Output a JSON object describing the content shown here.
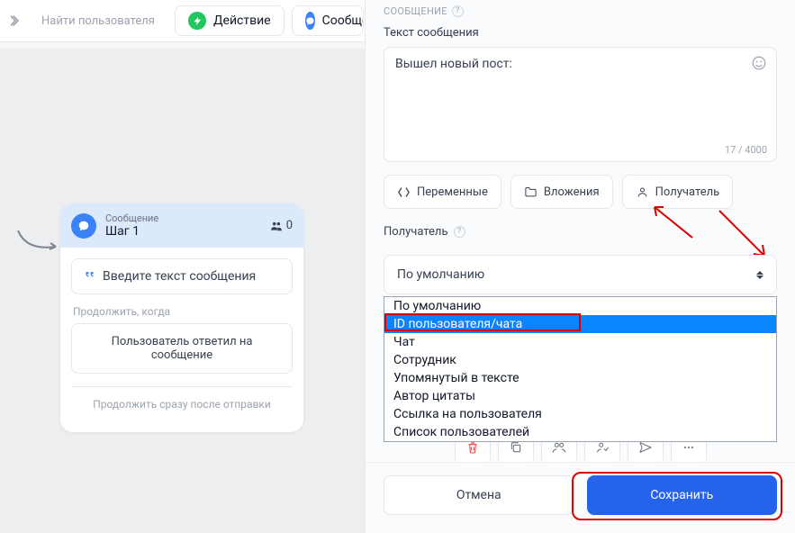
{
  "topbar": {
    "search_placeholder": "Найти пользователя",
    "action_chip": "Действие",
    "message_chip": "Сообщение"
  },
  "node": {
    "supertitle": "Сообщение",
    "title": "Шаг 1",
    "people_count": "0",
    "message_placeholder": "Введите текст сообщения",
    "continue_when": "Продолжить, когда",
    "condition": "Пользователь ответил на сообщение",
    "continue_immediately": "Продолжить сразу после отправки"
  },
  "panel": {
    "section": "СООБЩЕНИЕ",
    "text_label": "Текст сообщения",
    "text_value": "Вышел новый пост:",
    "char_counter": "17 / 4000",
    "btn_variables": "Переменные",
    "btn_attachments": "Вложения",
    "btn_recipient": "Получатель",
    "recipient_label": "Получатель",
    "select_value": "По умолчанию",
    "options": [
      "По умолчанию",
      "ID пользователя/чата",
      "Чат",
      "Сотрудник",
      "Упомянутый в тексте",
      "Автор цитаты",
      "Ссылка на пользователя",
      "Список пользователей"
    ],
    "footer": {
      "cancel": "Отмена",
      "save": "Сохранить"
    }
  }
}
